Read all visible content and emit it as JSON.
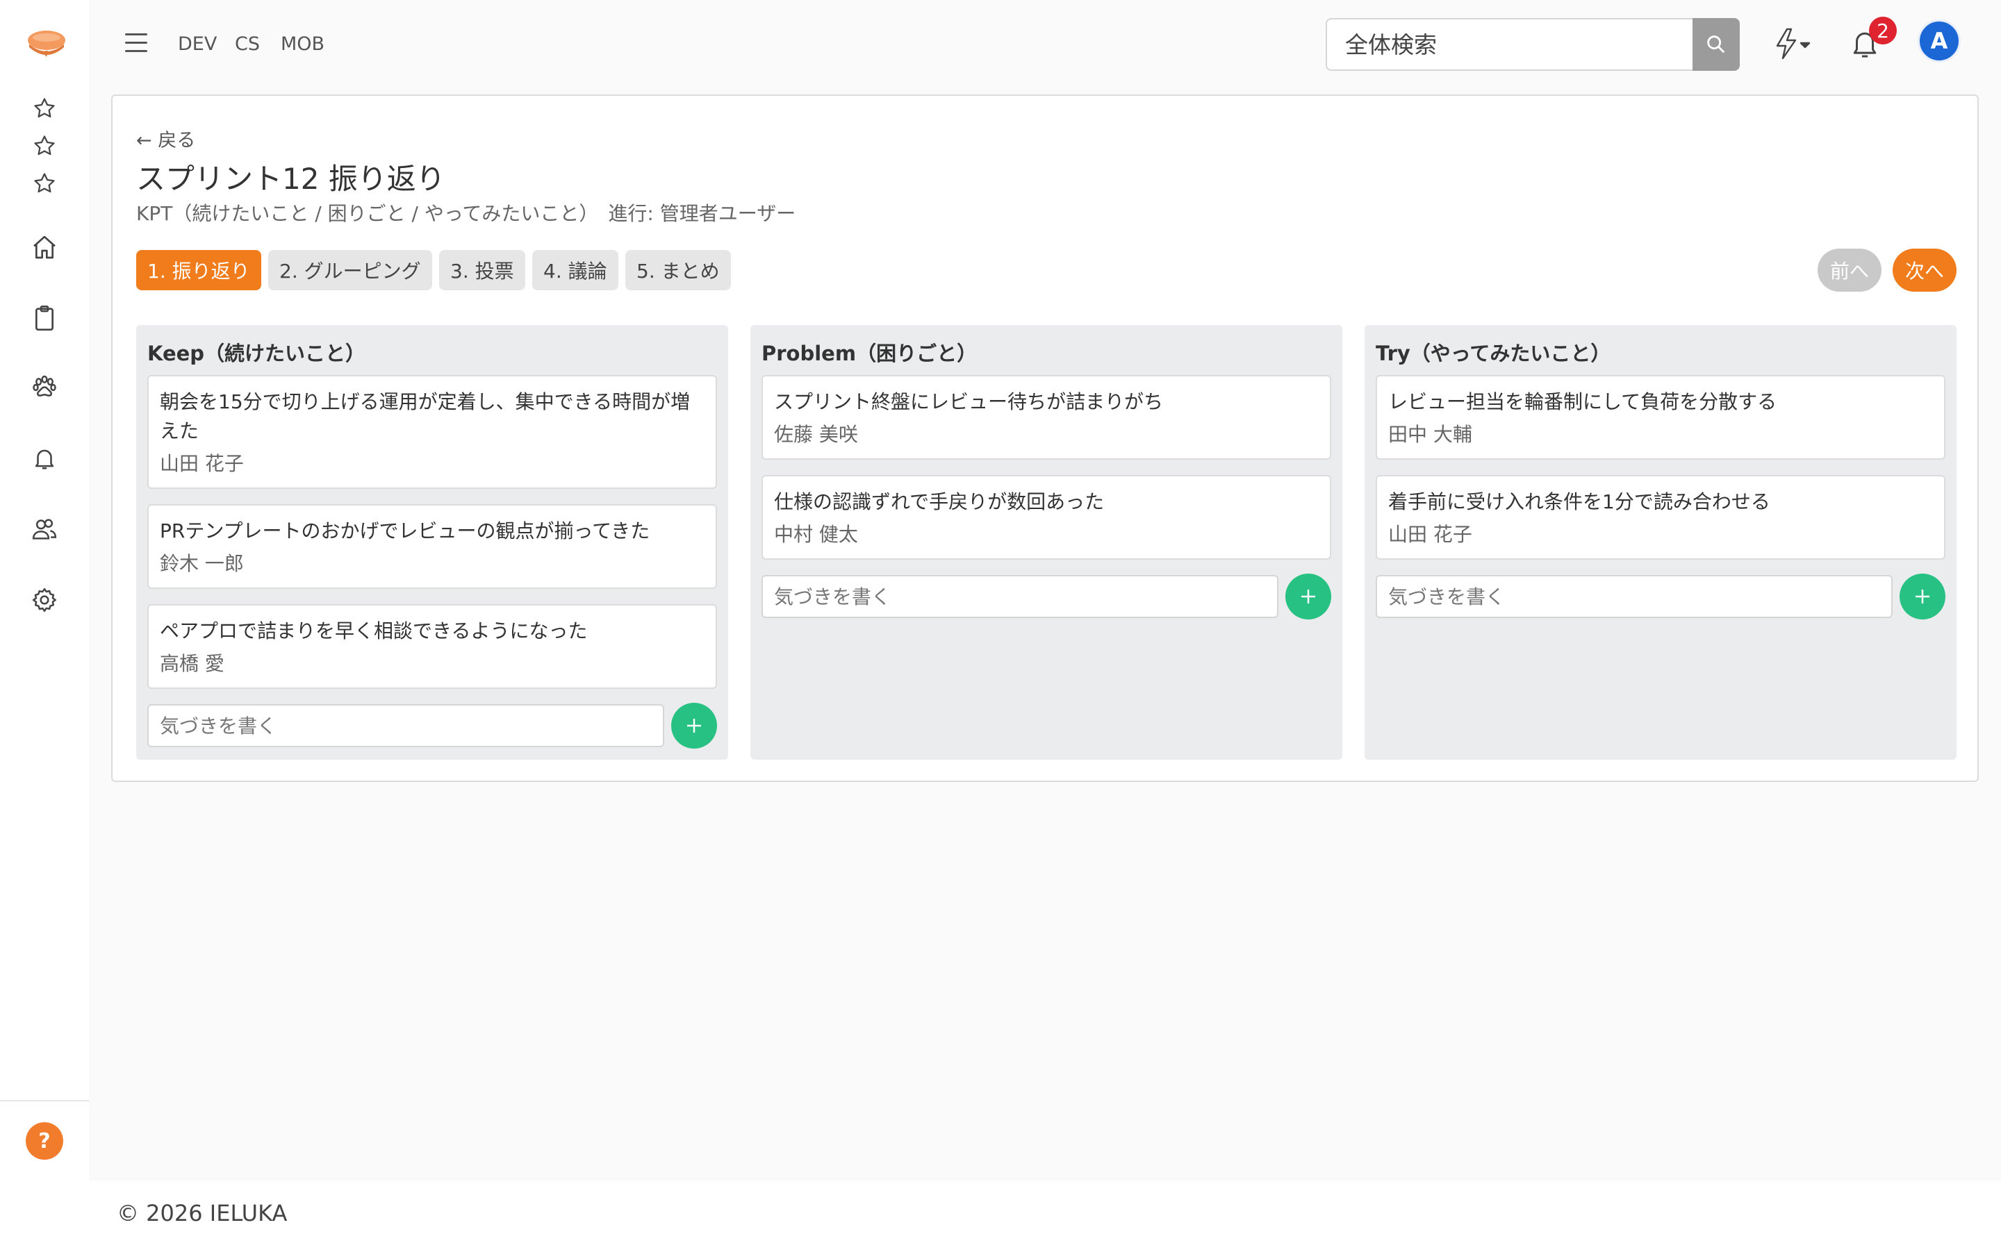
{
  "colors": {
    "accent_orange": "#f07c1c",
    "success_green": "#27c184",
    "avatar_blue": "#1b67d6",
    "badge_red": "#e0242f"
  },
  "header": {
    "menu_icon": "hamburger-icon",
    "nav": [
      "DEV",
      "CS",
      "MOB"
    ],
    "search_placeholder": "全体検索",
    "notification_count": "2",
    "avatar_letter": "A"
  },
  "sidebar": {
    "icons": [
      "star-icon",
      "star-icon",
      "star-icon",
      "home-icon",
      "clipboard-icon",
      "paw-icon",
      "bell-icon",
      "users-icon",
      "gear-icon"
    ],
    "help_label": "?"
  },
  "page": {
    "back_label": "← 戻る",
    "title": "スプリント12 振り返り",
    "subtitle": "KPT（続けたいこと / 困りごと / やってみたいこと）　進行: 管理者ユーザー",
    "steps": [
      "1. 振り返り",
      "2. グルーピング",
      "3. 投票",
      "4. 議論",
      "5. まとめ"
    ],
    "active_step": 0,
    "prev_label": "前へ",
    "next_label": "次へ"
  },
  "columns": [
    {
      "title": "Keep（続けたいこと）",
      "cards": [
        {
          "text": "朝会を15分で切り上げる運用が定着し、集中できる時間が増えた",
          "author": "山田 花子"
        },
        {
          "text": "PRテンプレートのおかげでレビューの観点が揃ってきた",
          "author": "鈴木 一郎"
        },
        {
          "text": "ペアプロで詰まりを早く相談できるようになった",
          "author": "高橋 愛"
        }
      ],
      "input_placeholder": "気づきを書く"
    },
    {
      "title": "Problem（困りごと）",
      "cards": [
        {
          "text": "スプリント終盤にレビュー待ちが詰まりがち",
          "author": "佐藤 美咲"
        },
        {
          "text": "仕様の認識ずれで手戻りが数回あった",
          "author": "中村 健太"
        }
      ],
      "input_placeholder": "気づきを書く"
    },
    {
      "title": "Try（やってみたいこと）",
      "cards": [
        {
          "text": "レビュー担当を輪番制にして負荷を分散する",
          "author": "田中 大輔"
        },
        {
          "text": "着手前に受け入れ条件を1分で読み合わせる",
          "author": "山田 花子"
        }
      ],
      "input_placeholder": "気づきを書く"
    }
  ],
  "footer": {
    "copyright": "© 2026 IELUKA"
  }
}
